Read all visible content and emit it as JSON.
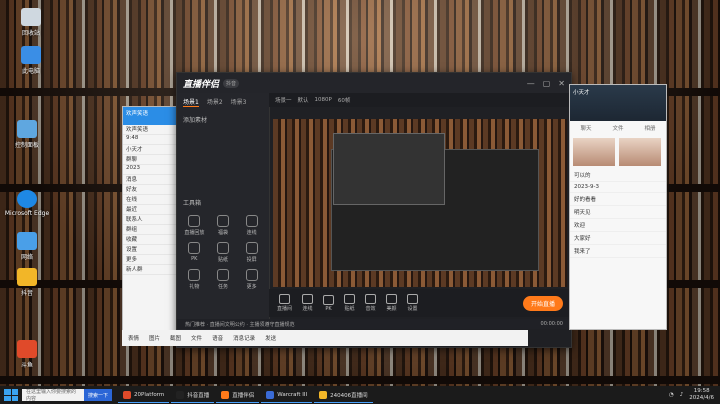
{
  "desktop": {
    "icons": [
      "回收站",
      "此电脑",
      "Microsoft Edge",
      "网络",
      "控制面板",
      "抖音",
      "斗鱼"
    ]
  },
  "chat_list": {
    "title": "欢声笑语",
    "rows": [
      "欢声笑语",
      "9:48",
      "小天才",
      "群聊",
      "2023",
      "消息",
      "好友",
      "在线",
      "最近",
      "联系人",
      "群组",
      "收藏",
      "设置",
      "更多",
      "新人群"
    ]
  },
  "app": {
    "logo": "直播伴侣",
    "badge": "抖音",
    "sidebar_tabs": [
      "场景1",
      "场景2",
      "场景3"
    ],
    "add_label": "添加素材",
    "tools_title": "工具箱",
    "tools": [
      "直播回放",
      "福袋",
      "连线",
      "PK",
      "贴纸",
      "投屏",
      "礼物",
      "任务",
      "更多"
    ],
    "toolbar2": [
      "场景一",
      "默认",
      "1080P",
      "60帧"
    ],
    "bottombar": [
      "直播间",
      "连线",
      "PK",
      "贴纸",
      "音效",
      "美颜",
      "设置"
    ],
    "live_button": "开始直播",
    "status_text": "热门推荐 · 直播间文明公约 · 主播须遵守直播规范",
    "status_time": "00:00:00"
  },
  "strip": [
    "表情",
    "图片",
    "截图",
    "文件",
    "语音",
    "消息记录",
    "发送"
  ],
  "right_panel": {
    "title": "小天才",
    "tabs": [
      "聊天",
      "文件",
      "相册"
    ],
    "messages": [
      "可以的",
      "2023-9-3",
      "好的看看",
      "明天见",
      "欢迎",
      "大家好",
      "我来了"
    ]
  },
  "taskbar": {
    "search_placeholder": "在这里输入你要搜索的内容",
    "search_button": "搜索一下",
    "apps": [
      "20Platform",
      "抖音直播",
      "直播伴侣",
      "Warcraft III",
      "240406直播间"
    ],
    "time": "19:58",
    "date": "2024/4/6"
  }
}
